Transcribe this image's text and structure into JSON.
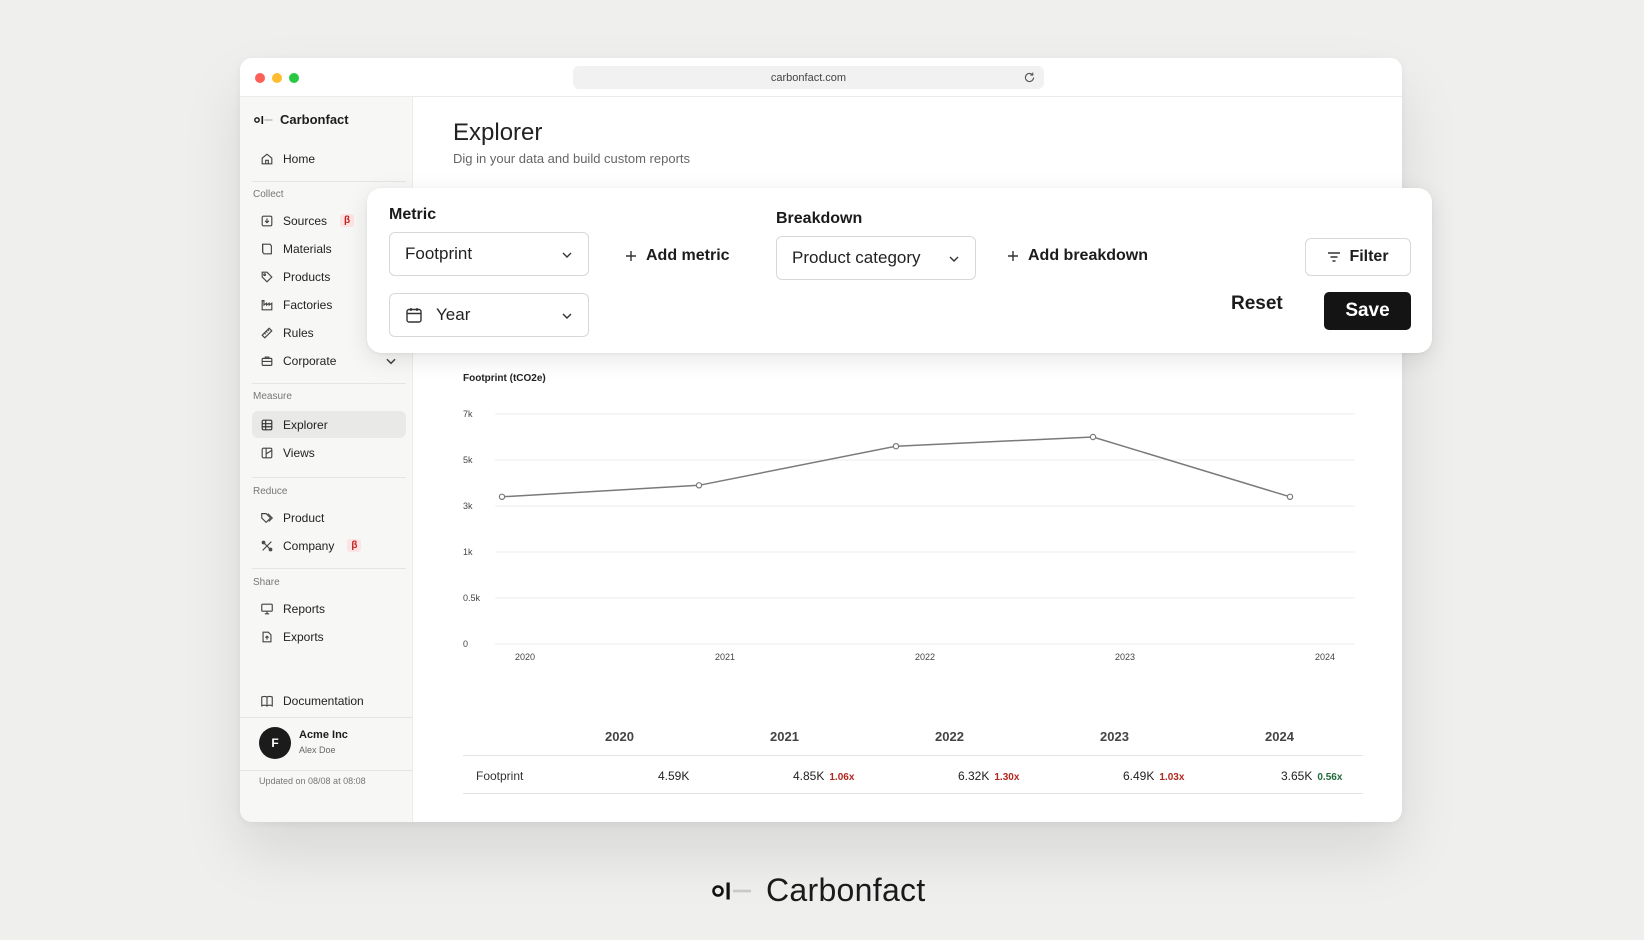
{
  "browser": {
    "url": "carbonfact.com"
  },
  "brand": {
    "name": "Carbonfact"
  },
  "sidebar": {
    "home": "Home",
    "sections": {
      "collect": "Collect",
      "measure": "Measure",
      "reduce": "Reduce",
      "share": "Share"
    },
    "items": {
      "sources": "Sources",
      "materials": "Materials",
      "products": "Products",
      "factories": "Factories",
      "rules": "Rules",
      "corporate": "Corporate",
      "explorer": "Explorer",
      "views": "Views",
      "product": "Product",
      "company": "Company",
      "reports": "Reports",
      "exports": "Exports",
      "documentation": "Documentation"
    },
    "beta_badge": "β",
    "account": {
      "initial": "F",
      "org": "Acme Inc",
      "user": "Alex Doe"
    },
    "updated": "Updated on 08/08 at 08:08"
  },
  "page": {
    "title": "Explorer",
    "subtitle": "Dig in your data and build custom reports"
  },
  "controls": {
    "metric_label": "Metric",
    "metric_value": "Footprint",
    "add_metric": "Add metric",
    "breakdown_label": "Breakdown",
    "breakdown_value": "Product category",
    "add_breakdown": "Add breakdown",
    "filter": "Filter",
    "period_value": "Year",
    "reset": "Reset",
    "save": "Save"
  },
  "colors": {
    "line": "#7a7a7a",
    "increase": "#b3261e",
    "decrease": "#1f6b3a",
    "save_bg": "#141414"
  },
  "chart_data": {
    "type": "line",
    "ylabel": "Footprint (tCO2e)",
    "x": [
      "2020",
      "2021",
      "2022",
      "2023",
      "2024"
    ],
    "y_ticks": [
      "7k",
      "5k",
      "3k",
      "1k",
      "0.5k",
      "0"
    ],
    "series": [
      {
        "values": [
          3.4,
          3.9,
          5.6,
          6.0,
          3.4
        ]
      }
    ],
    "grid": true
  },
  "table": {
    "columns": [
      "2020",
      "2021",
      "2022",
      "2023",
      "2024"
    ],
    "rows": [
      {
        "label": "Footprint",
        "cells": [
          {
            "value": "4.59K",
            "ratio": ""
          },
          {
            "value": "4.85K",
            "ratio": "1.06x"
          },
          {
            "value": "6.32K",
            "ratio": "1.30x"
          },
          {
            "value": "6.49K",
            "ratio": "1.03x"
          },
          {
            "value": "3.65K",
            "ratio": "0.56x"
          }
        ]
      }
    ]
  }
}
